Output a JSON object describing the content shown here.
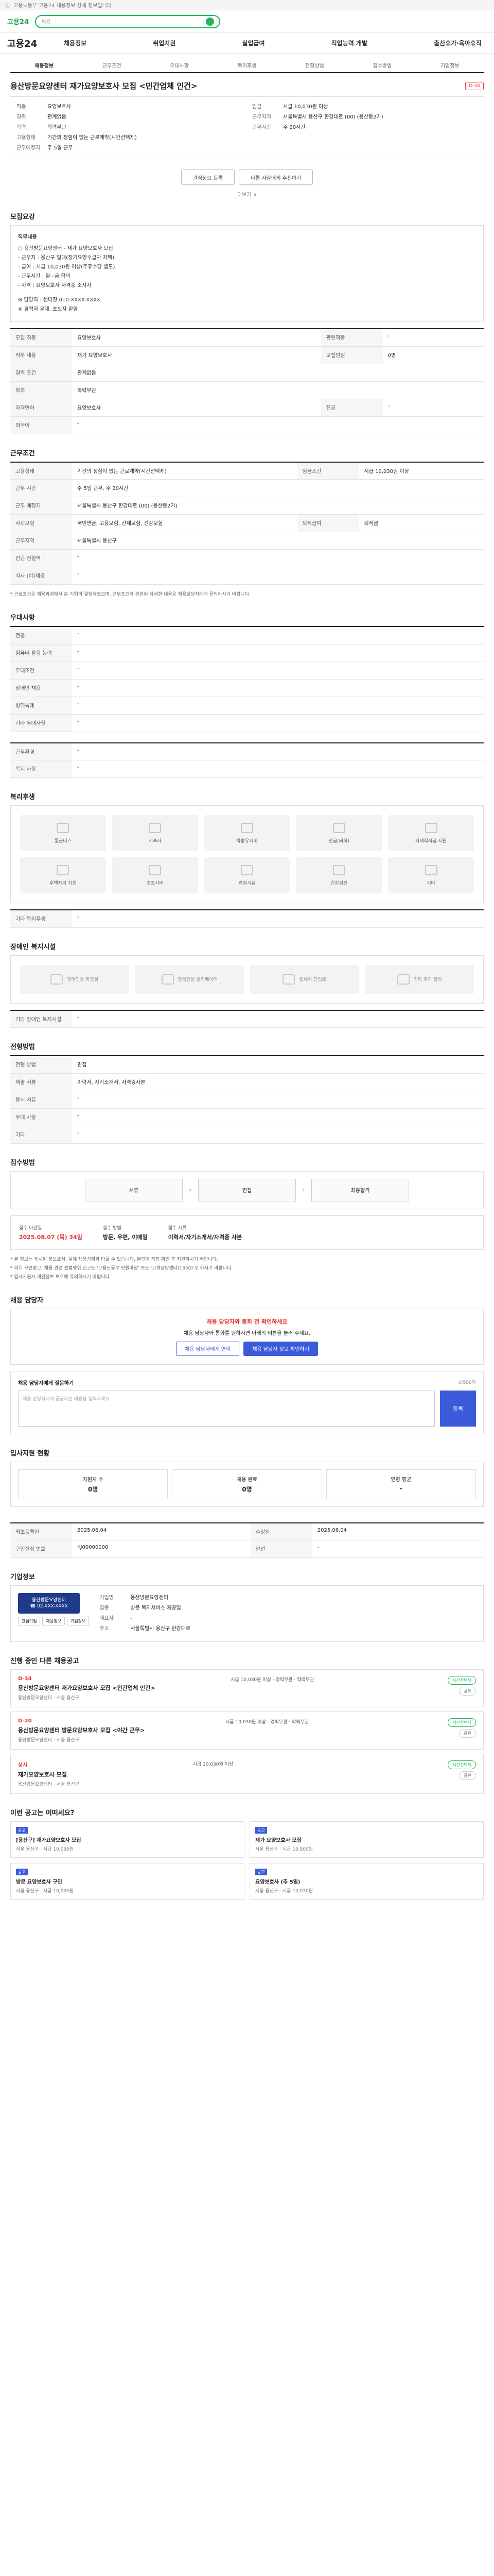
{
  "topbar": {
    "text": "고용노동부 고용24 채용정보 상세 정보입니다"
  },
  "header": {
    "logo": "고용24",
    "search_placeholder": "채용"
  },
  "gnb": {
    "brand": "고용24",
    "menu": [
      "채용정보",
      "취업지원",
      "실업급여",
      "직업능력 개발",
      "출산휴가·육아휴직"
    ]
  },
  "tabs": [
    "채용정보",
    "근무조건",
    "우대사항",
    "복리후생",
    "전형방법",
    "접수방법",
    "기업정보"
  ],
  "title": {
    "text": "용산방문요양센터 재가요양보호사 모집 <민간업체 인건>",
    "badge": "D-34"
  },
  "summary": {
    "left": [
      {
        "k": "직종",
        "v": "요양보호사"
      },
      {
        "k": "경력",
        "v": "관계없음"
      },
      {
        "k": "학력",
        "v": "학력무관"
      },
      {
        "k": "고용형태",
        "v": "기간의 정함이 없는 근로계약(시간선택제)"
      },
      {
        "k": "근무예정지",
        "v": "주 5일 근무"
      }
    ],
    "right": [
      {
        "k": "임금",
        "v": "시급 10,030원 이상"
      },
      {
        "k": "근무지역",
        "v": "서울특별시 용산구 한강대로 (00) (용산동2가)"
      },
      {
        "k": "근무시간",
        "v": "주 20시간"
      }
    ]
  },
  "actions": {
    "scrap": "관심정보 등록",
    "share": "다른 사람에게 추천하기",
    "more": "더보기 ∨"
  },
  "sections": {
    "job_content": "모집요강",
    "work_conditions": "근무조건",
    "preferences": "우대사항",
    "welfare": "복리후생",
    "barrier_free": "장애인 복지시설",
    "selection": "전형방법",
    "application": "접수방법",
    "contact": "채용 담당자",
    "inquiry": "입사지원 현황",
    "company": "기업정보",
    "other_jobs": "진행 중인 다른 채용공고",
    "recommend": "이런 공고는 어떠세요?"
  },
  "job_description": {
    "title": "직무내용",
    "lines": [
      "○ 용산방문요양센터 - 재가 요양보호사 모집",
      "- 근무지 : 용산구 일대(장기요양수급자 자택)",
      "- 급여 : 시급 10,030원 이상(주휴수당 별도)",
      "- 근무시간 : 월~금 협의",
      "- 자격 : 요양보호사 자격증 소지자",
      "",
      "※ 담당자 : 센터장 010-XXXX-XXXX",
      "※ 경력자 우대, 초보자 환영"
    ]
  },
  "job_table": [
    {
      "k": "모집 직종",
      "v": "요양보호사",
      "k2": "관련직종",
      "v2": "-"
    },
    {
      "k": "직무 내용",
      "v": "재가 요양보호사",
      "k2": "모집인원",
      "v2": "0명"
    },
    {
      "k": "경력 조건",
      "v": "관계없음",
      "k2": "",
      "v2": ""
    },
    {
      "k": "학력",
      "v": "학력무관",
      "k2": "",
      "v2": ""
    },
    {
      "k": "자격면허",
      "v": "요양보호사",
      "k2": "전공",
      "v2": "-"
    },
    {
      "k": "외국어",
      "v": "-",
      "k2": "",
      "v2": ""
    }
  ],
  "work_table": [
    {
      "k": "고용형태",
      "v": "기간의 정함이 없는 근로계약(시간선택제)",
      "k2": "임금조건",
      "v2": "시급 10,030원 이상"
    },
    {
      "k": "근무 시간",
      "v": "주 5일 근무, 주 20시간",
      "k2": "",
      "v2": ""
    },
    {
      "k": "근무 예정지",
      "v": "서울특별시 용산구 한강대로 (00) (용산동2가)",
      "k2": "",
      "v2": ""
    },
    {
      "k": "사회보험",
      "v": "국민연금, 고용보험, 산재보험, 건강보험",
      "k2": "퇴직급여",
      "v2": "퇴직금"
    },
    {
      "k": "근무지역",
      "v": "서울특별시 용산구",
      "k2": "",
      "v2": ""
    },
    {
      "k": "인근 전철역",
      "v": "-",
      "k2": "",
      "v2": ""
    },
    {
      "k": "식사 (비)제공",
      "v": "-",
      "k2": "",
      "v2": ""
    }
  ],
  "work_note": "* 근로조건은 채용과정에서 본 기업이 결정하였으며, 근무조건과 관련된 자세한 내용은 채용담당자에게 문의하시기 바랍니다.",
  "pref_table": [
    {
      "k": "전공",
      "v": "-"
    },
    {
      "k": "컴퓨터 활용 능력",
      "v": "-"
    },
    {
      "k": "우대조건",
      "v": "-"
    },
    {
      "k": "장애인 채용",
      "v": "-"
    },
    {
      "k": "병역특례",
      "v": "-"
    },
    {
      "k": "기타 우대사항",
      "v": "-"
    }
  ],
  "other_table": [
    {
      "k": "근무환경",
      "v": "-"
    },
    {
      "k": "복지 사항",
      "v": "-"
    }
  ],
  "welfare_items": [
    "통근버스",
    "기숙사",
    "차량유지비",
    "연금(퇴직)",
    "자녀학자금 지원",
    "주택자금 지원",
    "경조사비",
    "휴양시설",
    "건강검진",
    "기타"
  ],
  "welfare_extra": {
    "k": "기타 복리후생",
    "v": "-"
  },
  "barrier_items": [
    "장애인용 화장실",
    "장애인용 엘리베이터",
    "휠체어 진입로",
    "기타 추가 항목"
  ],
  "barrier_extra": {
    "k": "기타 장애인 복지시설",
    "v": "-"
  },
  "selection_table": [
    {
      "k": "전형 방법",
      "v": "면접"
    },
    {
      "k": "제출 서류",
      "v": "이력서, 자기소개서, 자격증사본"
    },
    {
      "k": "응시 서류",
      "v": "-"
    },
    {
      "k": "우대 사항",
      "v": "-"
    },
    {
      "k": "기타",
      "v": "-"
    }
  ],
  "process_steps": [
    "서류",
    "면접",
    "최종합격"
  ],
  "apply": {
    "date_label": "접수 마감일",
    "date": "2025.08.07 (목) 34일",
    "method_label": "접수 방법",
    "method": "방문, 우편, 이메일",
    "extra_label": "접수 서류",
    "extra": "이력서/자기소개서/자격증 사본"
  },
  "notes": [
    "* 본 정보는 게시된 정보로서, 실제 채용상황과 다를 수 있습니다. 본인이 직접 확인 후 지원하시기 바랍니다.",
    "* 허위 구인광고, 채용 관련 불법행위 신고는 '고용노동부 민원마당' 또는 '고객상담센터(1350)'로 하시기 바랍니다.",
    "* 입사지원시 개인정보 보호에 유의하시기 바랍니다."
  ],
  "contact": {
    "warn": "채용 담당자와 통화 전 확인하세요",
    "desc": "채용 담당자와 통화를 원하시면 아래의 버튼을 눌러 주세요.",
    "btn1": "채용 담당자에게 연락",
    "btn2": "채용 담당자 정보 확인하기"
  },
  "inquiry": {
    "title": "채용 담당자에게 질문하기",
    "placeholder": "채용 담당자에게 궁금하신 내용을 입력하세요.",
    "submit": "등록",
    "counter": "0/500자"
  },
  "status": [
    {
      "label": "지원자 수",
      "value": "0명"
    },
    {
      "label": "채용 완료",
      "value": "0명"
    },
    {
      "label": "연령 평균",
      "value": "-"
    }
  ],
  "info_table": [
    {
      "k": "최초등록일",
      "v": "2025.06.04",
      "k2": "수정일",
      "v2": "2025.06.04"
    },
    {
      "k": "구인신청 번호",
      "v": "KJ00000000",
      "k2": "알선",
      "v2": "-"
    }
  ],
  "company": {
    "logo": "용산방문요양센터",
    "phone": "☎ 02-XXX-XXXX",
    "rows": [
      {
        "k": "기업명",
        "v": "용산방문요양센터"
      },
      {
        "k": "업종",
        "v": "방문 복지서비스 제공업"
      },
      {
        "k": "대표자",
        "v": "-"
      },
      {
        "k": "주소",
        "v": "서울특별시 용산구 한강대로"
      }
    ],
    "btns": [
      "관심기업",
      "채용정보",
      "기업정보"
    ]
  },
  "jobs": [
    {
      "dday": "D-34",
      "title": "용산방문요양센터 재가요양보호사 모집 <민간업체 인건>",
      "meta": "용산방문요양센터 · 서울 용산구",
      "info": "시급 10,030원 이상 · 경력무관 · 학력무관",
      "pill1": "시간선택제",
      "pill2": "공유"
    },
    {
      "dday": "D-20",
      "title": "용산방문요양센터 방문요양보호사 모집 <야간 근무>",
      "meta": "용산방문요양센터 · 서울 용산구",
      "info": "시급 10,030원 이상 · 경력무관 · 학력무관",
      "pill1": "시간선택제",
      "pill2": "공유"
    },
    {
      "dday": "상시",
      "title": "재가요양보호사 모집",
      "meta": "용산방문요양센터 · 서울 용산구",
      "info": "시급 10,030원 이상",
      "pill1": "시간선택제",
      "pill2": "공유"
    }
  ],
  "recommend": [
    {
      "lbl": "공고",
      "title": "[용산구] 재가요양보호사 모집",
      "meta": "서울 용산구 · 시급 10,030원"
    },
    {
      "lbl": "공고",
      "title": "재가 요양보호사 모집",
      "meta": "서울 용산구 · 시급 10,500원"
    },
    {
      "lbl": "공고",
      "title": "방문 요양보호사 구인",
      "meta": "서울 용산구 · 시급 10,030원"
    },
    {
      "lbl": "공고",
      "title": "요양보호사 (주 5일)",
      "meta": "서울 용산구 · 시급 10,030원"
    }
  ]
}
